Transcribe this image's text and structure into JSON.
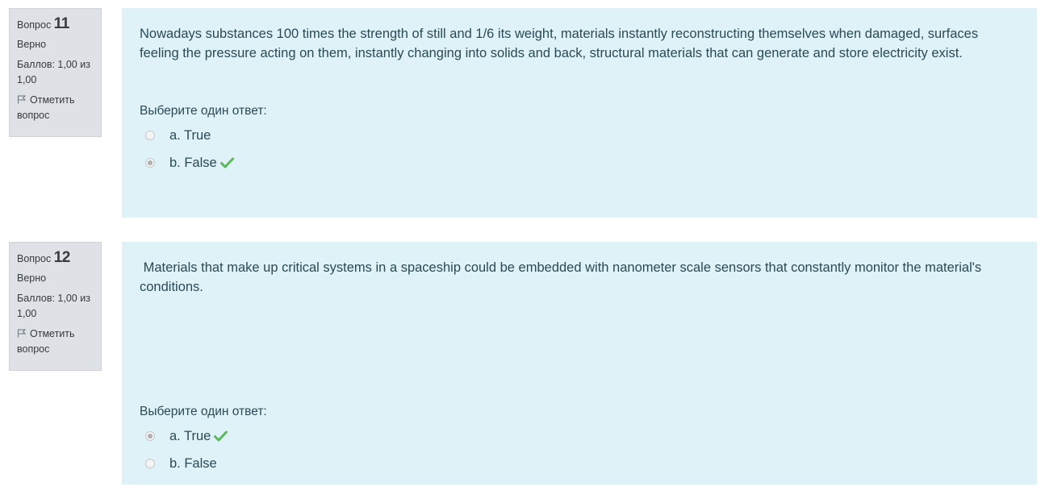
{
  "questions": [
    {
      "info": {
        "label": "Вопрос",
        "number": "11",
        "state": "Верно",
        "grade": "Баллов: 1,00 из 1,00",
        "flag_label": "Отметить вопрос"
      },
      "text": "Nowadays substances 100 times the strength of still and 1/6 its weight, materials instantly reconstructing themselves when damaged, surfaces feeling the pressure acting on them, instantly changing into solids and back, structural materials that can generate and store electricity exist.",
      "prompt": "Выберите один ответ:",
      "answers": [
        {
          "label": "a. True",
          "checked": false,
          "correct_mark": false
        },
        {
          "label": "b. False",
          "checked": true,
          "correct_mark": true
        }
      ]
    },
    {
      "info": {
        "label": "Вопрос",
        "number": "12",
        "state": "Верно",
        "grade": "Баллов: 1,00 из 1,00",
        "flag_label": "Отметить вопрос"
      },
      "text": " Materials that make up critical systems in a spaceship could be embedded with nanometer scale sensors that constantly monitor the material's conditions.",
      "prompt": "Выберите один ответ:",
      "answers": [
        {
          "label": "a. True",
          "checked": true,
          "correct_mark": true
        },
        {
          "label": "b. False",
          "checked": false,
          "correct_mark": false
        }
      ]
    }
  ],
  "colors": {
    "info_bg": "#dee2e6",
    "content_bg": "#def2f8",
    "correct_check": "#5cb85c"
  },
  "icons": {
    "flag": "flag-icon",
    "correct": "check-icon"
  }
}
